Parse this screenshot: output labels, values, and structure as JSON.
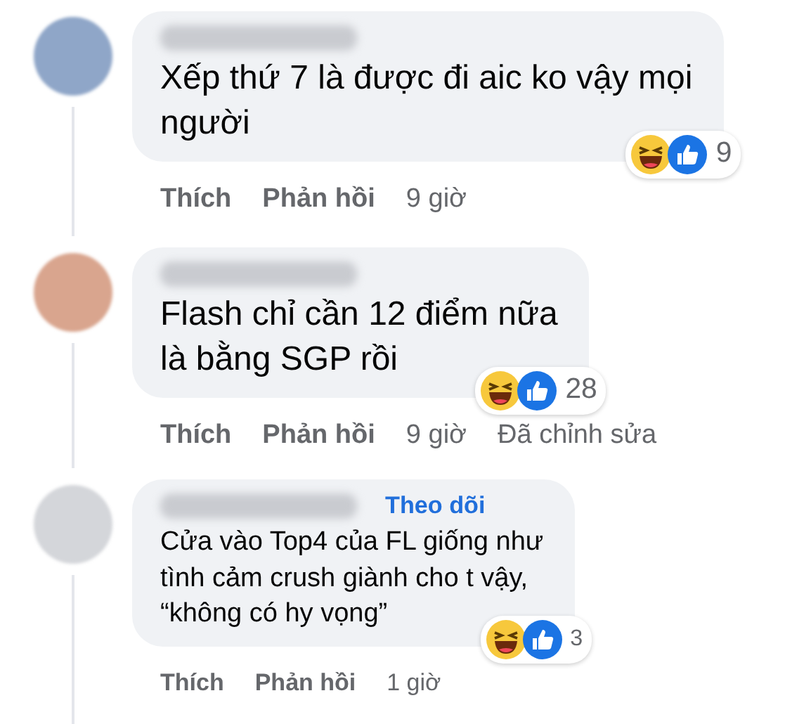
{
  "comments": [
    {
      "lines": [
        "Xếp thứ 7 là được đi aic ko vậy mọi",
        "người"
      ],
      "reactions": {
        "count": "9"
      },
      "actions": [
        "Thích",
        "Phản hồi"
      ],
      "time": "9 giờ"
    },
    {
      "lines": [
        "Flash chỉ cần 12 điểm nữa",
        "là bằng SGP rồi"
      ],
      "reactions": {
        "count": "28"
      },
      "actions": [
        "Thích",
        "Phản hồi"
      ],
      "time": "9 giờ",
      "edited": "Đã chỉnh sửa"
    },
    {
      "follow": "Theo dõi",
      "lines": [
        "Cửa vào Top4 của FL giống như",
        "tình cảm crush giành cho t vậy,",
        "“không có hy vọng”"
      ],
      "reactions": {
        "count": "3"
      },
      "actions": [
        "Thích",
        "Phản hồi"
      ],
      "time": "1 giờ"
    }
  ]
}
